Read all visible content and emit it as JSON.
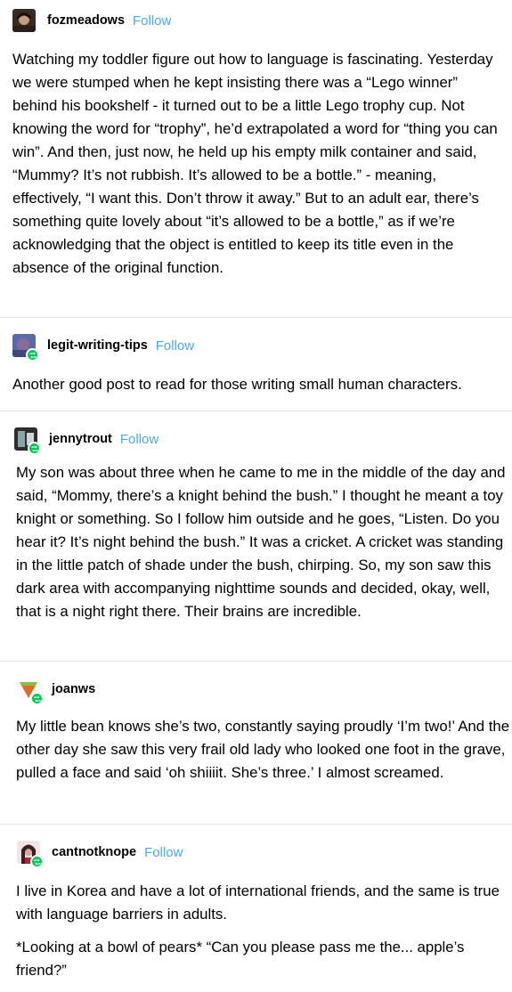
{
  "posts": [
    {
      "username": "fozmeadows",
      "follow_label": "Follow",
      "paragraphs": [
        "Watching my toddler figure out how to language is fascinating. Yesterday we were stumped when he kept insisting there was a “Lego winner” behind his bookshelf - it turned out to be a little Lego trophy cup. Not knowing the word for “trophy”, he’d extrapolated a word for “thing you can win”. And then, just now, he held up his empty milk container and said, “Mummy? It’s not rubbish. It’s allowed to be a bottle.” - meaning, effectively, “I want this. Don’t throw it away.” But to an adult ear, there’s something quite lovely about “it’s allowed to be a bottle,” as if we’re acknowledging that the object is entitled to keep its title even in the absence of the original function."
      ]
    },
    {
      "username": "legit-writing-tips",
      "follow_label": "Follow",
      "paragraphs": [
        "Another good post to read for those writing small human characters."
      ]
    },
    {
      "username": "jennytrout",
      "follow_label": "Follow",
      "paragraphs": [
        "My son was about three when he came to me in the middle of the day and said, “Mommy, there’s a knight behind the bush.” I thought he meant a toy knight or something. So I follow him outside and he goes, “Listen. Do you hear it? It’s night behind the bush.” It was a cricket. A cricket was standing in the little patch of shade under the bush, chirping. So, my son saw this dark area with accompanying nighttime sounds and decided, okay, well, that is a night right there. Their brains are incredible."
      ]
    },
    {
      "username": "joanws",
      "paragraphs": [
        "My little bean knows she’s two, constantly saying proudly ‘I’m two!’ And the other day she saw this very frail old lady who looked one foot in the grave, pulled a face and said ‘oh shiiiit. She’s three.’ I almost screamed."
      ]
    },
    {
      "username": "cantnotknope",
      "follow_label": "Follow",
      "paragraphs": [
        "I live in Korea and have a lot of international friends, and the same is true with language barriers in adults.",
        "*Looking at a bowl of pears* “Can you please pass me the... apple’s friend?”"
      ]
    }
  ],
  "colors": {
    "follow": "#4ba8f0",
    "reblog_badge": "#00c653",
    "divider": "#e2e2e2"
  },
  "icons": {
    "reblog": "reblog-arrows-icon"
  }
}
